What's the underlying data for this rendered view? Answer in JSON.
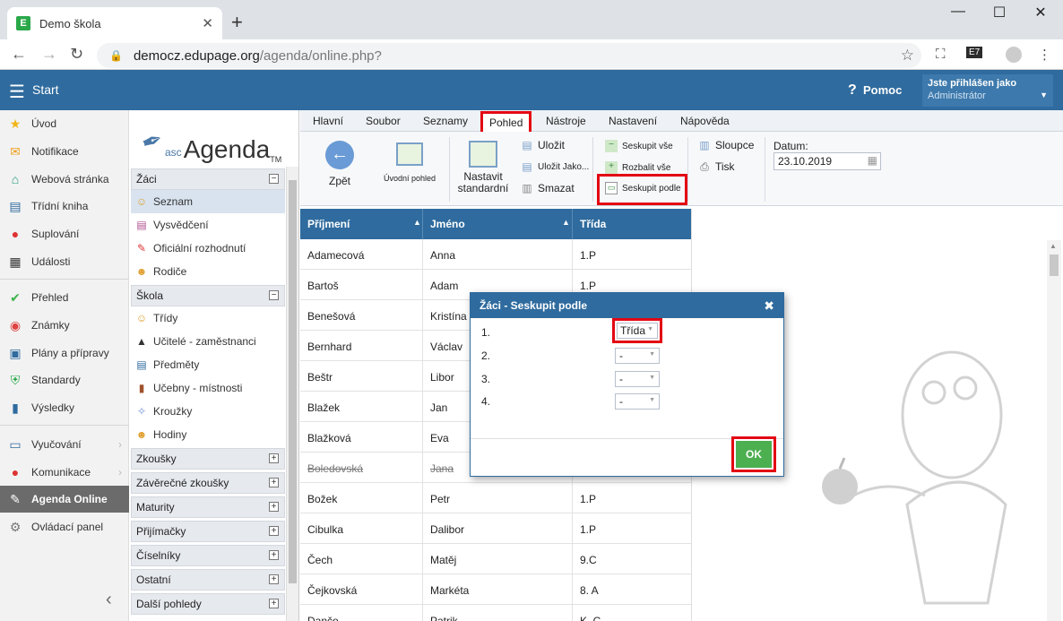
{
  "browser": {
    "tab_title": "Demo škola",
    "tab_favicon": "E",
    "url_host": "democz.edupage.org",
    "url_path": "/agenda/online.php?"
  },
  "header": {
    "start_label": "Start",
    "help_label": "Pomoc",
    "user_line1": "Jste přihlášen jako",
    "user_line2": "Administrátor"
  },
  "leftnav": {
    "items": [
      {
        "label": "Úvod",
        "icon": "star-icon"
      },
      {
        "label": "Notifikace",
        "icon": "envelope-icon"
      },
      {
        "label": "Webová stránka",
        "icon": "home-icon"
      },
      {
        "label": "Třídní kniha",
        "icon": "book-icon"
      },
      {
        "label": "Suplování",
        "icon": "person-icon"
      },
      {
        "label": "Události",
        "icon": "calendar-icon"
      },
      {
        "label": "Přehled",
        "icon": "check-icon"
      },
      {
        "label": "Známky",
        "icon": "grade-icon"
      },
      {
        "label": "Plány a přípravy",
        "icon": "briefcase-icon"
      },
      {
        "label": "Standardy",
        "icon": "shield-icon"
      },
      {
        "label": "Výsledky",
        "icon": "bar-chart-icon"
      },
      {
        "label": "Vyučování",
        "icon": "open-book-icon"
      },
      {
        "label": "Komunikace",
        "icon": "chat-icon"
      },
      {
        "label": "Agenda Online",
        "icon": "agenda-icon"
      },
      {
        "label": "Ovládací panel",
        "icon": "gear-icon"
      }
    ]
  },
  "panel": {
    "logo_asc": "asc",
    "logo_agenda": "Agenda",
    "logo_tm": "TM",
    "section_zaci": "Žáci",
    "zaci_items": [
      "Seznam",
      "Vysvědčení",
      "Oficiální rozhodnutí",
      "Rodiče"
    ],
    "section_skola": "Škola",
    "skola_items": [
      "Třídy",
      "Učitelé - zaměstnanci",
      "Předměty",
      "Učebny - místnosti",
      "Kroužky",
      "Hodiny"
    ],
    "collapsed_sections": [
      "Zkoušky",
      "Závěrečné zkoušky",
      "Maturity",
      "Přijímačky",
      "Číselníky",
      "Ostatní",
      "Další pohledy"
    ]
  },
  "menu": {
    "tabs": [
      "Hlavní",
      "Soubor",
      "Seznamy",
      "Pohled",
      "Nástroje",
      "Nastavení",
      "Nápověda"
    ]
  },
  "ribbon": {
    "back": "Zpět",
    "home_view": "Úvodní pohled",
    "set_standard_1": "Nastavit",
    "set_standard_2": "standardní",
    "save": "Uložit",
    "save_as": "Uložit Jako...",
    "delete": "Smazat",
    "group_all": "Seskupit vše",
    "expand_all": "Rozbalit vše",
    "group_by": "Seskupit podle",
    "columns": "Sloupce",
    "print": "Tisk",
    "date_label": "Datum:",
    "date_value": "23.10.2019"
  },
  "grid": {
    "columns": [
      "Příjmení",
      "Jméno",
      "Třída"
    ],
    "rows": [
      {
        "last": "Adamecová",
        "first": "Anna",
        "class": "1.P"
      },
      {
        "last": "Bartoš",
        "first": "Adam",
        "class": "1.P"
      },
      {
        "last": "Benešová",
        "first": "Kristína",
        "class": ""
      },
      {
        "last": "Bernhard",
        "first": "Václav",
        "class": ""
      },
      {
        "last": "Beštr",
        "first": "Libor",
        "class": ""
      },
      {
        "last": "Blažek",
        "first": "Jan",
        "class": ""
      },
      {
        "last": "Blažková",
        "first": "Eva",
        "class": ""
      },
      {
        "last": "Boledovská",
        "first": "Jana",
        "class": ""
      },
      {
        "last": "Božek",
        "first": "Petr",
        "class": "1.P"
      },
      {
        "last": "Cibulka",
        "first": "Dalibor",
        "class": "1.P"
      },
      {
        "last": "Čech",
        "first": "Matěj",
        "class": "9.C"
      },
      {
        "last": "Čejkovská",
        "first": "Markéta",
        "class": "8. A"
      },
      {
        "last": "Dančo",
        "first": "Patrik",
        "class": "K. C"
      }
    ]
  },
  "dialog": {
    "title": "Žáci - Seskupit podle",
    "nums": [
      "1.",
      "2.",
      "3.",
      "4."
    ],
    "values": [
      "Třída",
      "-",
      "-",
      "-"
    ],
    "ok": "OK"
  }
}
